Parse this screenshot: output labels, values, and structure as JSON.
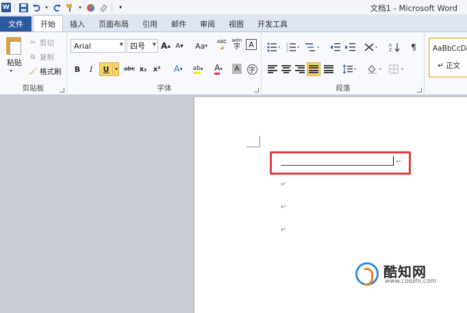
{
  "window": {
    "title": "文档1 - Microsoft Word",
    "app_logo_letter": "W",
    "qat_icons": [
      "save-icon",
      "undo-icon",
      "redo-icon",
      "format-painter-icon",
      "color-icon",
      "eraser-icon",
      "customize-qat-icon"
    ]
  },
  "tabs": [
    {
      "label": "文件"
    },
    {
      "label": "开始"
    },
    {
      "label": "插入"
    },
    {
      "label": "页面布局"
    },
    {
      "label": "引用"
    },
    {
      "label": "邮件"
    },
    {
      "label": "审阅"
    },
    {
      "label": "视图"
    },
    {
      "label": "开发工具"
    }
  ],
  "ribbon": {
    "clipboard": {
      "label": "剪贴板",
      "paste": "粘贴",
      "cut": "剪切",
      "copy": "复制",
      "format_painter": "格式刷"
    },
    "font": {
      "label": "字体",
      "font_name": "Arial",
      "font_size": "四号",
      "grow": "A",
      "shrink": "A",
      "change_case": "Aa",
      "clear_format_glyph": "ABC",
      "phonetic_glyph": "wén",
      "char_border": "A",
      "bold": "B",
      "italic": "I",
      "underline": "U",
      "strikethrough": "abc",
      "subscript": "x₂",
      "superscript": "x²",
      "text_effect": "A",
      "highlight": "ab",
      "font_color": "A",
      "char_shading": "A",
      "enclose_char": "字",
      "colors": {
        "highlight": "#f4e12a",
        "font_color": "#e12b2b",
        "effect": "#3d7fd6"
      }
    },
    "paragraph": {
      "label": "段落"
    },
    "styles": {
      "sample": "AaBbCcDc",
      "name": "↵ 正文"
    }
  },
  "document": {
    "paragraph_mark": "↵",
    "highlight_color": "#e0393e"
  },
  "watermark": {
    "brand": "酷知网",
    "url": "www.coozhi.com"
  }
}
